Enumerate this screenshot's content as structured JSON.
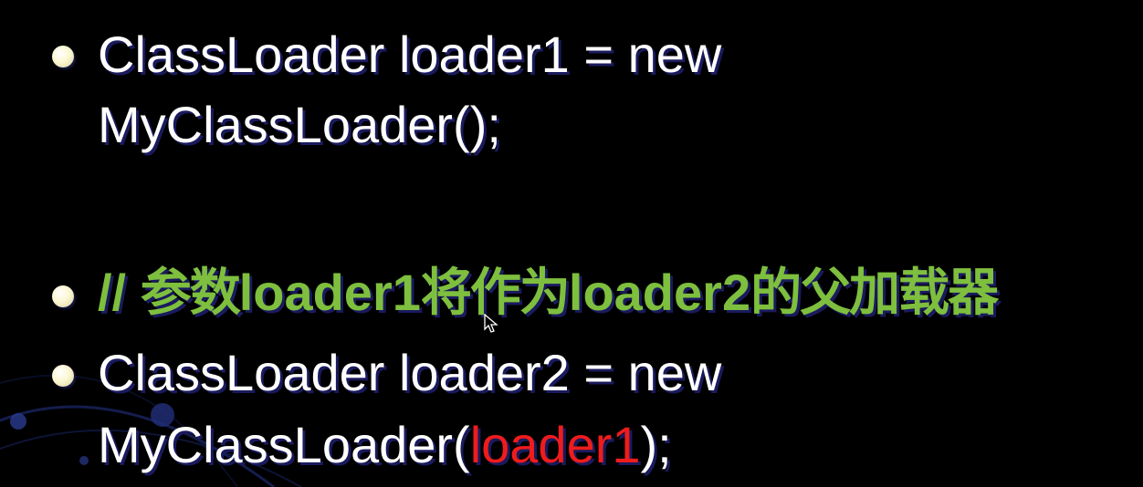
{
  "slide": {
    "bullets": [
      {
        "line1": "ClassLoader loader1 = new",
        "line2": "MyClassLoader();"
      },
      {
        "comment_prefix": "// ",
        "comment_cjk_1": "参数",
        "comment_code_1": "loader1",
        "comment_cjk_2": "将作为",
        "comment_code_2": "loader2",
        "comment_cjk_3": "的父加载器"
      },
      {
        "line1": "ClassLoader loader2 = new",
        "line2_prefix": "MyClassLoader(",
        "line2_arg": "loader1",
        "line2_suffix": ");"
      }
    ]
  },
  "colors": {
    "background": "#000000",
    "text": "#ffffff",
    "comment": "#7ebf3e",
    "highlight": "#ee1c1c",
    "bullet": "#fbf7d2",
    "text_shadow": "#1a1a5e"
  },
  "icons": {
    "bullet": "bullet-dot-icon",
    "cursor": "mouse-pointer-icon"
  }
}
